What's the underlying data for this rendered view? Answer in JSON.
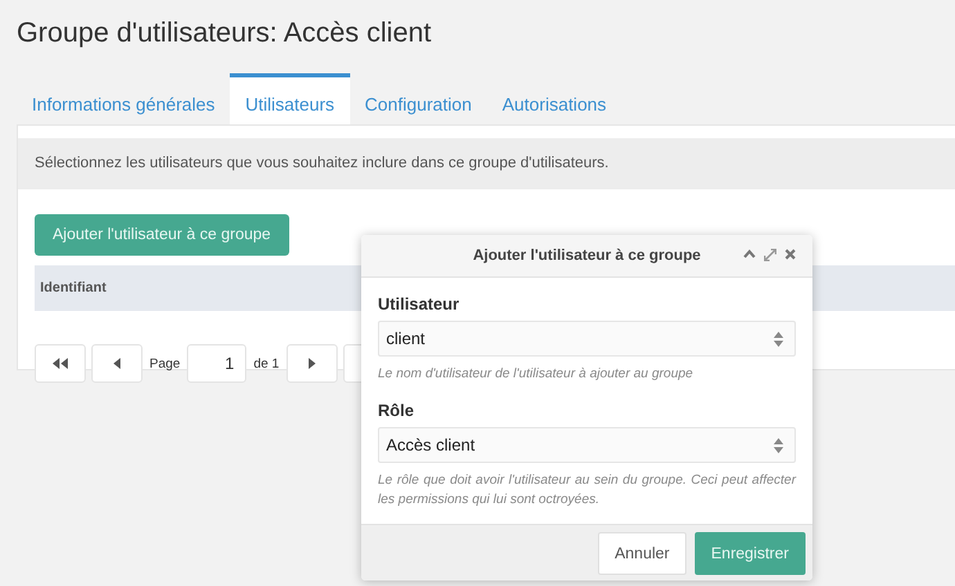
{
  "page_title": "Groupe d'utilisateurs: Accès client",
  "tabs": [
    {
      "label": "Informations générales",
      "selected": false
    },
    {
      "label": "Utilisateurs",
      "selected": true
    },
    {
      "label": "Configuration",
      "selected": false
    },
    {
      "label": "Autorisations",
      "selected": false
    }
  ],
  "description": "Sélectionnez les utilisateurs que vous souhaitez inclure dans ce groupe d'utilisateurs.",
  "add_button": "Ajouter l'utilisateur à ce groupe",
  "table": {
    "columns": [
      "Identifiant"
    ]
  },
  "pager": {
    "page_label": "Page",
    "page": "1",
    "of_label": "de 1"
  },
  "dialog": {
    "title": "Ajouter l'utilisateur à ce groupe",
    "fields": [
      {
        "label": "Utilisateur",
        "value": "client",
        "help": "Le nom d'utilisateur de l'utilisateur à ajouter au groupe"
      },
      {
        "label": "Rôle",
        "value": "Accès client",
        "help": "Le rôle que doit avoir l'utilisateur au sein du groupe. Ceci peut affecter les permissions qui lui sont octroyées."
      }
    ],
    "buttons": [
      {
        "label": "Annuler",
        "kind": "secondary"
      },
      {
        "label": "Enregistrer",
        "kind": "primary"
      }
    ]
  }
}
